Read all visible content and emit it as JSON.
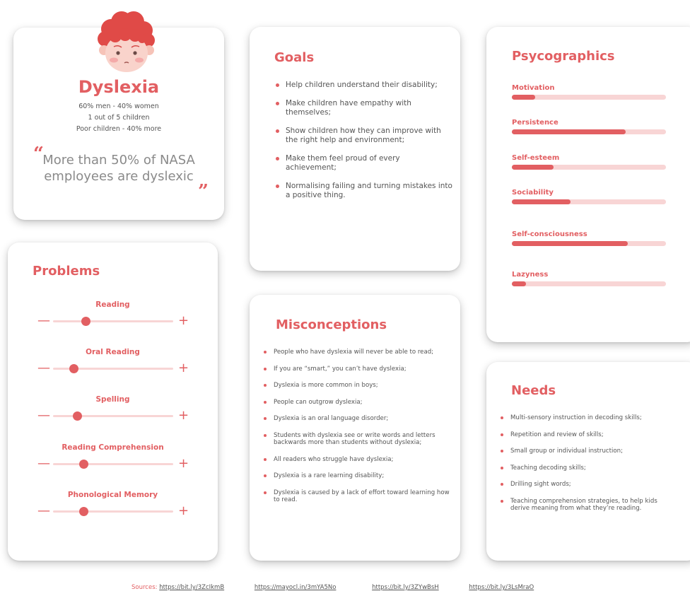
{
  "persona": {
    "name": "Dyslexia",
    "stats": [
      "60% men - 40% women",
      "1 out of 5 children",
      "Poor children - 40% more"
    ],
    "quote": "More than 50% of NASA employees are dyslexic",
    "open_quote": "“",
    "close_quote": "”",
    "avatar_icon": "child-face-red-hair"
  },
  "goals": {
    "title": "Goals",
    "items": [
      "Help children understand their disability;",
      "Make children have empathy with themselves;",
      "Show children how they can improve with the right help and environment;",
      "Make them feel proud of every achievement;",
      "Normalising failing and turning mistakes into a positive thing."
    ]
  },
  "psycographics": {
    "title": "Psycographics",
    "items": [
      {
        "label": "Motivation",
        "value": 0.15
      },
      {
        "label": "Persistence",
        "value": 0.74
      },
      {
        "label": "Self-esteem",
        "value": 0.27
      },
      {
        "label": "Sociability",
        "value": 0.38
      },
      {
        "label": "Self-consciousness",
        "value": 0.75
      },
      {
        "label": "Lazyness",
        "value": 0.09
      }
    ]
  },
  "problems": {
    "title": "Problems",
    "minus": "—",
    "plus": "+",
    "sliders": [
      {
        "label": "Reading",
        "value": 0.27
      },
      {
        "label": "Oral Reading",
        "value": 0.17
      },
      {
        "label": "Spelling",
        "value": 0.2
      },
      {
        "label": "Reading Comprehension",
        "value": 0.25
      },
      {
        "label": "Phonological Memory",
        "value": 0.25
      }
    ]
  },
  "misconceptions": {
    "title": "Misconceptions",
    "items": [
      "People who have dyslexia will never be able to read;",
      "If you are “smart,” you can’t have dyslexia;",
      "Dyslexia is more common in boys;",
      "People can outgrow dyslexia;",
      "Dyslexia is an oral language disorder;",
      "Students with dyslexia see or write words and letters backwards more than students without dyslexia;",
      "All readers who struggle have dyslexia;",
      "Dyslexia is a rare learning disability;",
      "Dyslexia is caused by a lack of effort toward learning how to read."
    ]
  },
  "needs": {
    "title": "Needs",
    "items": [
      "Multi-sensory instruction in decoding skills;",
      "Repetition and review of skills;",
      "Small group or individual instruction;",
      "Teaching decoding skills;",
      "Drilling sight words;",
      "Teaching comprehension strategies, to help kids derive meaning from what they’re reading."
    ]
  },
  "sources": {
    "label": "Sources:",
    "links": [
      "https://bit.ly/3ZcIkmB",
      "https://mayocl.in/3mYA5No",
      "https://bit.ly/3ZYwBsH",
      "https://bit.ly/3LsMraO"
    ]
  },
  "colors": {
    "accent": "#e25f62",
    "track": "#f8d5d5",
    "text": "#555555"
  }
}
